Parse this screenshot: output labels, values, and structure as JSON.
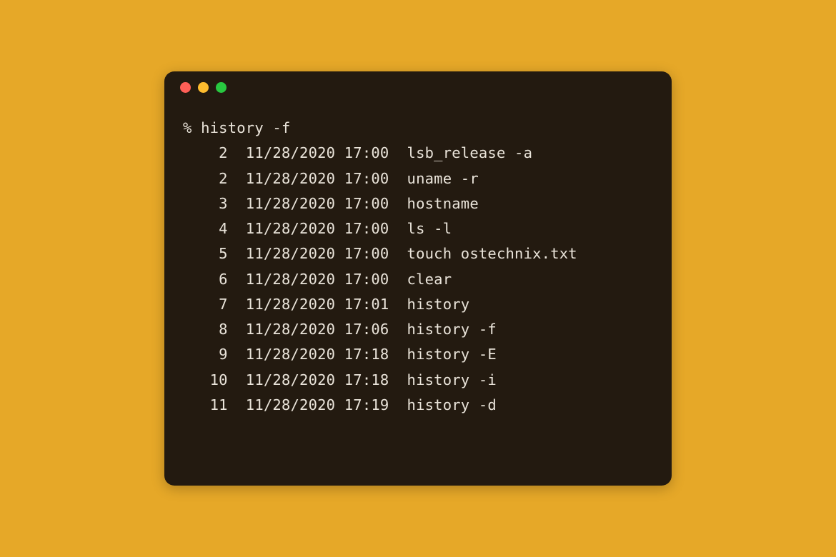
{
  "colors": {
    "page_bg": "#e6a828",
    "terminal_bg": "#231a10",
    "text": "#eae4da",
    "close": "#ff5f57",
    "minimize": "#febc2e",
    "maximize": "#28c840"
  },
  "prompt": {
    "symbol": "%",
    "command": "history -f"
  },
  "history": [
    {
      "num": "2",
      "date": "11/28/2020",
      "time": "17:00",
      "cmd": "lsb_release -a"
    },
    {
      "num": "2",
      "date": "11/28/2020",
      "time": "17:00",
      "cmd": "uname -r"
    },
    {
      "num": "3",
      "date": "11/28/2020",
      "time": "17:00",
      "cmd": "hostname"
    },
    {
      "num": "4",
      "date": "11/28/2020",
      "time": "17:00",
      "cmd": "ls -l"
    },
    {
      "num": "5",
      "date": "11/28/2020",
      "time": "17:00",
      "cmd": "touch ostechnix.txt"
    },
    {
      "num": "6",
      "date": "11/28/2020",
      "time": "17:00",
      "cmd": "clear"
    },
    {
      "num": "7",
      "date": "11/28/2020",
      "time": "17:01",
      "cmd": "history"
    },
    {
      "num": "8",
      "date": "11/28/2020",
      "time": "17:06",
      "cmd": "history -f"
    },
    {
      "num": "9",
      "date": "11/28/2020",
      "time": "17:18",
      "cmd": "history -E"
    },
    {
      "num": "10",
      "date": "11/28/2020",
      "time": "17:18",
      "cmd": "history -i"
    },
    {
      "num": "11",
      "date": "11/28/2020",
      "time": "17:19",
      "cmd": "history -d"
    }
  ]
}
